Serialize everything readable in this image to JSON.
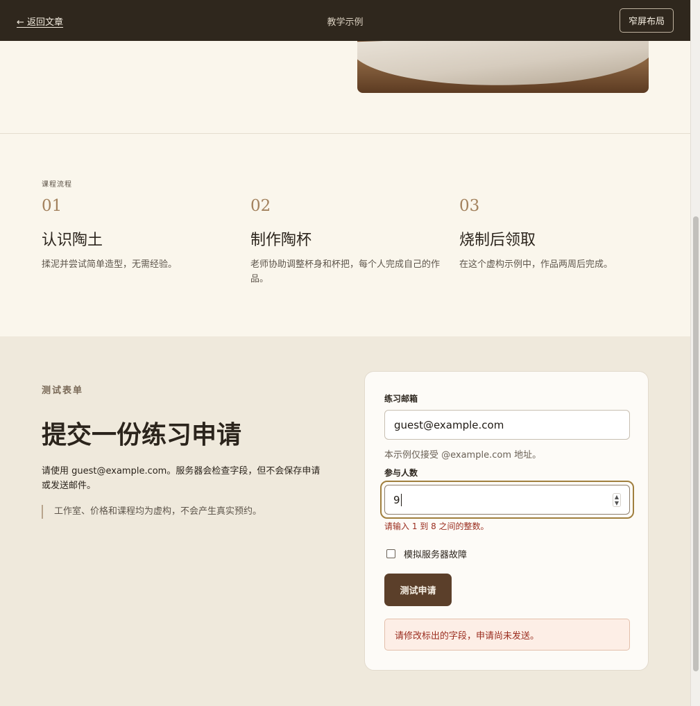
{
  "topbar": {
    "back_label": "← 返回文章",
    "title": "教学示例",
    "layout_button": "窄屏布局"
  },
  "process": {
    "eyebrow": "课程流程",
    "steps": [
      {
        "num": "01",
        "title": "认识陶土",
        "desc": "揉泥并尝试简单造型，无需经验。"
      },
      {
        "num": "02",
        "title": "制作陶杯",
        "desc": "老师协助调整杯身和杯把，每个人完成自己的作品。"
      },
      {
        "num": "03",
        "title": "烧制后领取",
        "desc": "在这个虚构示例中，作品两周后完成。"
      }
    ]
  },
  "form_section": {
    "eyebrow": "测试表单",
    "heading": "提交一份练习申请",
    "intro": "请使用 guest@example.com。服务器会检查字段，但不会保存申请或发送邮件。",
    "note": "工作室、价格和课程均为虚构，不会产生真实预约。"
  },
  "form": {
    "email_label": "练习邮箱",
    "email_value": "guest@example.com",
    "email_hint": "本示例仅接受 @example.com 地址。",
    "count_label": "参与人数",
    "count_value": "9",
    "count_error": "请输入 1 到 8 之间的整数。",
    "checkbox_label": "模拟服务器故障",
    "checkbox_checked": false,
    "submit_label": "测试申请",
    "alert_text": "请修改标出的字段，申请尚未发送。"
  },
  "colors": {
    "topbar": "#2f271d",
    "accent": "#5b3f2a",
    "error": "#9a2c1e",
    "focus_ring": "#a07f3e"
  }
}
